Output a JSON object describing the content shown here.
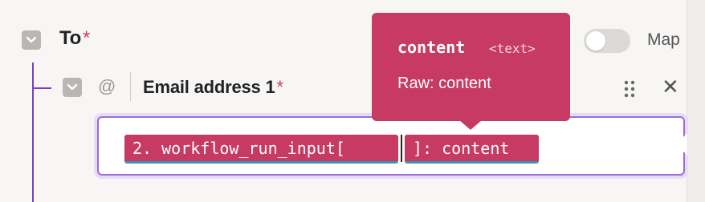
{
  "to_field": {
    "label": "To",
    "required_marker": "*",
    "map_label": "Map"
  },
  "email_field": {
    "label": "Email address 1",
    "required_marker": "*",
    "at_symbol": "@",
    "close_glyph": "✕"
  },
  "input": {
    "pills": [
      {
        "text": "2. workflow_run_input["
      },
      {
        "text": "]: content"
      }
    ]
  },
  "tooltip": {
    "name": "content",
    "type": "<text>",
    "raw": "Raw: content"
  },
  "icons": {
    "collapse": "chevron-down-icon",
    "drag": "drag-handle-icon",
    "close": "close-icon"
  },
  "colors": {
    "accent": "#c63a63",
    "tree_line": "#7a3fc8",
    "input_border": "#9c6ad8",
    "pill_underline": "#3e8fb4"
  }
}
